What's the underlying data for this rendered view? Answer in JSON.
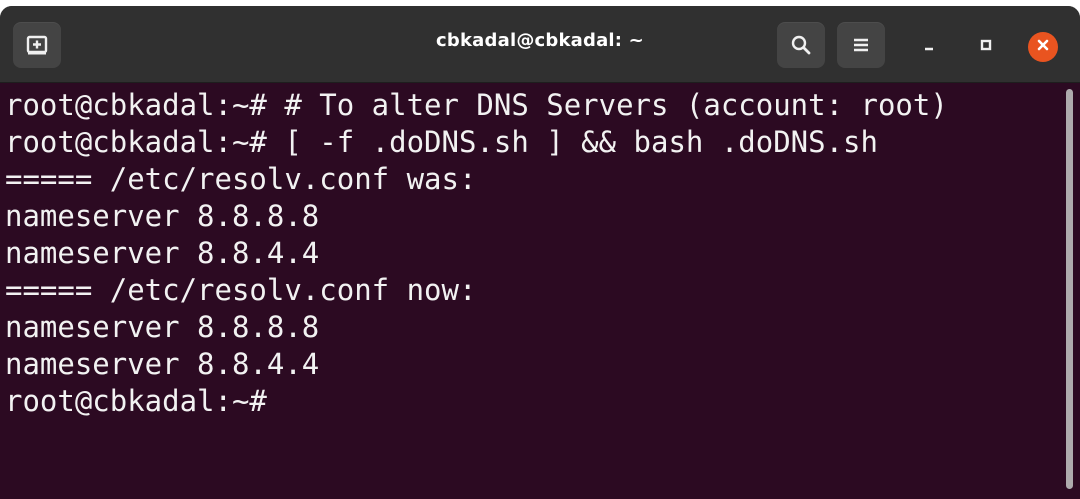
{
  "window": {
    "title": "cbkadal@cbkadal: ~"
  },
  "toolbar": {
    "new_tab_icon": "new-tab-icon",
    "search_icon": "search-icon",
    "menu_icon": "hamburger-menu-icon",
    "minimize_icon": "minimize-icon",
    "maximize_icon": "maximize-icon",
    "close_icon": "close-icon",
    "close_color": "#e95420"
  },
  "terminal": {
    "background": "#2c0a22",
    "lines": [
      "root@cbkadal:~# # To alter DNS Servers (account: root)",
      "root@cbkadal:~# [ -f .doDNS.sh ] && bash .doDNS.sh",
      "===== /etc/resolv.conf was:",
      "nameserver 8.8.8.8",
      "nameserver 8.8.4.4",
      "===== /etc/resolv.conf now:",
      "nameserver 8.8.8.8",
      "nameserver 8.8.4.4",
      "root@cbkadal:~#"
    ]
  }
}
